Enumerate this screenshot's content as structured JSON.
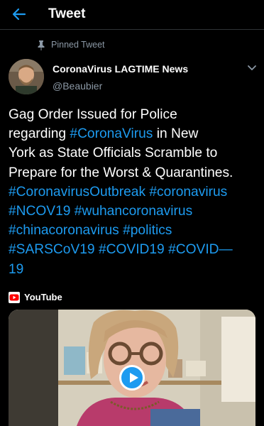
{
  "header": {
    "title": "Tweet",
    "back_icon": "arrow-left-icon"
  },
  "accent_color": "#1d9bf0",
  "tweet": {
    "pinned_label": "Pinned Tweet",
    "author_name": "CoronaVirus LAGTIME News",
    "author_handle": "@Beaubier",
    "lines": [
      [
        {
          "t": "Gag Order Issued for Police",
          "h": false
        }
      ],
      [
        {
          "t": "regarding ",
          "h": false
        },
        {
          "t": "#CoronaVirus",
          "h": true
        },
        {
          "t": " in New",
          "h": false
        }
      ],
      [
        {
          "t": "York as State Officials Scramble to",
          "h": false
        }
      ],
      [
        {
          "t": "Prepare for the Worst & Quarantines.",
          "h": false
        }
      ],
      [
        {
          "t": "#CoronavirusOutbreak",
          "h": true
        },
        {
          "t": " ",
          "h": false
        },
        {
          "t": "#coronavirus",
          "h": true
        }
      ],
      [
        {
          "t": "#NCOV19",
          "h": true
        },
        {
          "t": " ",
          "h": false
        },
        {
          "t": "#wuhancoronavirus",
          "h": true
        }
      ],
      [
        {
          "t": "#chinacoronavirus",
          "h": true
        },
        {
          "t": " ",
          "h": false
        },
        {
          "t": "#politics",
          "h": true
        }
      ],
      [
        {
          "t": "#SARSCoV19",
          "h": true
        },
        {
          "t": " ",
          "h": false
        },
        {
          "t": "#COVID19",
          "h": true
        },
        {
          "t": " ",
          "h": false
        },
        {
          "t": "#COVID—",
          "h": true
        }
      ],
      [
        {
          "t": "19",
          "h": true
        }
      ]
    ]
  },
  "card": {
    "source_label": "YouTube",
    "source_icon": "youtube-icon",
    "play_icon": "play-icon"
  }
}
